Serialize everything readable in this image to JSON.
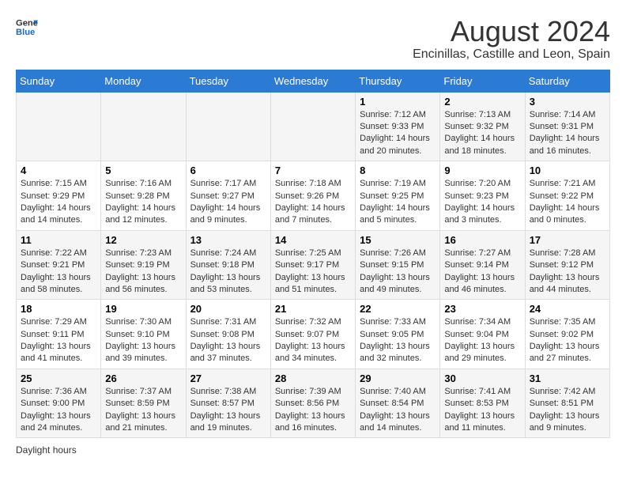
{
  "header": {
    "logo_general": "General",
    "logo_blue": "Blue",
    "title": "August 2024",
    "subtitle": "Encinillas, Castille and Leon, Spain"
  },
  "days_of_week": [
    "Sunday",
    "Monday",
    "Tuesday",
    "Wednesday",
    "Thursday",
    "Friday",
    "Saturday"
  ],
  "weeks": [
    [
      {
        "day": "",
        "info": ""
      },
      {
        "day": "",
        "info": ""
      },
      {
        "day": "",
        "info": ""
      },
      {
        "day": "",
        "info": ""
      },
      {
        "day": "1",
        "info": "Sunrise: 7:12 AM\nSunset: 9:33 PM\nDaylight: 14 hours and 20 minutes."
      },
      {
        "day": "2",
        "info": "Sunrise: 7:13 AM\nSunset: 9:32 PM\nDaylight: 14 hours and 18 minutes."
      },
      {
        "day": "3",
        "info": "Sunrise: 7:14 AM\nSunset: 9:31 PM\nDaylight: 14 hours and 16 minutes."
      }
    ],
    [
      {
        "day": "4",
        "info": "Sunrise: 7:15 AM\nSunset: 9:29 PM\nDaylight: 14 hours and 14 minutes."
      },
      {
        "day": "5",
        "info": "Sunrise: 7:16 AM\nSunset: 9:28 PM\nDaylight: 14 hours and 12 minutes."
      },
      {
        "day": "6",
        "info": "Sunrise: 7:17 AM\nSunset: 9:27 PM\nDaylight: 14 hours and 9 minutes."
      },
      {
        "day": "7",
        "info": "Sunrise: 7:18 AM\nSunset: 9:26 PM\nDaylight: 14 hours and 7 minutes."
      },
      {
        "day": "8",
        "info": "Sunrise: 7:19 AM\nSunset: 9:25 PM\nDaylight: 14 hours and 5 minutes."
      },
      {
        "day": "9",
        "info": "Sunrise: 7:20 AM\nSunset: 9:23 PM\nDaylight: 14 hours and 3 minutes."
      },
      {
        "day": "10",
        "info": "Sunrise: 7:21 AM\nSunset: 9:22 PM\nDaylight: 14 hours and 0 minutes."
      }
    ],
    [
      {
        "day": "11",
        "info": "Sunrise: 7:22 AM\nSunset: 9:21 PM\nDaylight: 13 hours and 58 minutes."
      },
      {
        "day": "12",
        "info": "Sunrise: 7:23 AM\nSunset: 9:19 PM\nDaylight: 13 hours and 56 minutes."
      },
      {
        "day": "13",
        "info": "Sunrise: 7:24 AM\nSunset: 9:18 PM\nDaylight: 13 hours and 53 minutes."
      },
      {
        "day": "14",
        "info": "Sunrise: 7:25 AM\nSunset: 9:17 PM\nDaylight: 13 hours and 51 minutes."
      },
      {
        "day": "15",
        "info": "Sunrise: 7:26 AM\nSunset: 9:15 PM\nDaylight: 13 hours and 49 minutes."
      },
      {
        "day": "16",
        "info": "Sunrise: 7:27 AM\nSunset: 9:14 PM\nDaylight: 13 hours and 46 minutes."
      },
      {
        "day": "17",
        "info": "Sunrise: 7:28 AM\nSunset: 9:12 PM\nDaylight: 13 hours and 44 minutes."
      }
    ],
    [
      {
        "day": "18",
        "info": "Sunrise: 7:29 AM\nSunset: 9:11 PM\nDaylight: 13 hours and 41 minutes."
      },
      {
        "day": "19",
        "info": "Sunrise: 7:30 AM\nSunset: 9:10 PM\nDaylight: 13 hours and 39 minutes."
      },
      {
        "day": "20",
        "info": "Sunrise: 7:31 AM\nSunset: 9:08 PM\nDaylight: 13 hours and 37 minutes."
      },
      {
        "day": "21",
        "info": "Sunrise: 7:32 AM\nSunset: 9:07 PM\nDaylight: 13 hours and 34 minutes."
      },
      {
        "day": "22",
        "info": "Sunrise: 7:33 AM\nSunset: 9:05 PM\nDaylight: 13 hours and 32 minutes."
      },
      {
        "day": "23",
        "info": "Sunrise: 7:34 AM\nSunset: 9:04 PM\nDaylight: 13 hours and 29 minutes."
      },
      {
        "day": "24",
        "info": "Sunrise: 7:35 AM\nSunset: 9:02 PM\nDaylight: 13 hours and 27 minutes."
      }
    ],
    [
      {
        "day": "25",
        "info": "Sunrise: 7:36 AM\nSunset: 9:00 PM\nDaylight: 13 hours and 24 minutes."
      },
      {
        "day": "26",
        "info": "Sunrise: 7:37 AM\nSunset: 8:59 PM\nDaylight: 13 hours and 21 minutes."
      },
      {
        "day": "27",
        "info": "Sunrise: 7:38 AM\nSunset: 8:57 PM\nDaylight: 13 hours and 19 minutes."
      },
      {
        "day": "28",
        "info": "Sunrise: 7:39 AM\nSunset: 8:56 PM\nDaylight: 13 hours and 16 minutes."
      },
      {
        "day": "29",
        "info": "Sunrise: 7:40 AM\nSunset: 8:54 PM\nDaylight: 13 hours and 14 minutes."
      },
      {
        "day": "30",
        "info": "Sunrise: 7:41 AM\nSunset: 8:53 PM\nDaylight: 13 hours and 11 minutes."
      },
      {
        "day": "31",
        "info": "Sunrise: 7:42 AM\nSunset: 8:51 PM\nDaylight: 13 hours and 9 minutes."
      }
    ]
  ],
  "footer": {
    "daylight_label": "Daylight hours"
  }
}
